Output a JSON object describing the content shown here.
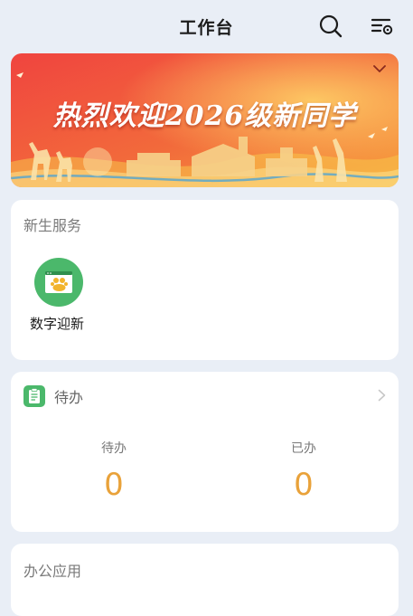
{
  "header": {
    "title": "工作台",
    "icons": [
      "search-icon",
      "settings-list-icon"
    ]
  },
  "banner": {
    "text": "热烈欢迎2026级新同学",
    "colors": {
      "primary": "#e8323a",
      "secondary": "#f7a13c"
    }
  },
  "new_student_service": {
    "title": "新生服务",
    "apps": [
      {
        "label": "数字迎新",
        "icon": "digital-welcome-icon",
        "icon_color": "#4bb86b"
      }
    ]
  },
  "todo": {
    "title": "待办",
    "icon": "clipboard-icon",
    "stats": [
      {
        "label": "待办",
        "value": "0"
      },
      {
        "label": "已办",
        "value": "0"
      }
    ],
    "value_color": "#e9a23a"
  },
  "office_apps": {
    "title": "办公应用"
  }
}
